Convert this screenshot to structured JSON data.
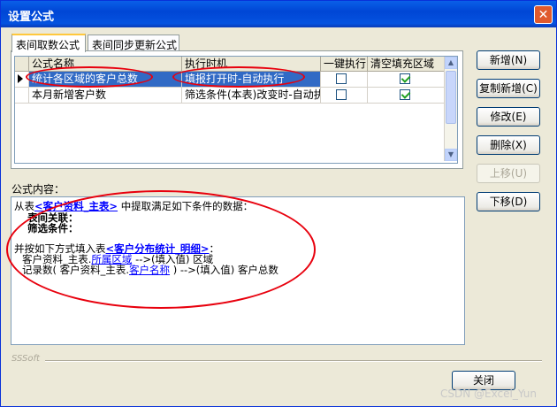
{
  "window": {
    "title": "设置公式",
    "close_glyph": "✕"
  },
  "tabs": [
    {
      "label": "表间取数公式",
      "active": true
    },
    {
      "label": "表间同步更新公式",
      "active": false
    }
  ],
  "grid": {
    "columns": [
      "公式名称",
      "执行时机",
      "一键执行",
      "清空填充区域"
    ],
    "rows": [
      {
        "name": "统计各区域的客户总数",
        "timing": "填报打开时-自动执行",
        "one_click": false,
        "clear_fill": true,
        "selected": true
      },
      {
        "name": "本月新增客户数",
        "timing": "筛选条件(本表)改变时-自动执",
        "one_click": false,
        "clear_fill": true,
        "selected": false
      }
    ]
  },
  "buttons": {
    "add": "新增(N)",
    "copy_add": "复制新增(C)",
    "edit": "修改(E)",
    "delete": "删除(X)",
    "move_up": "上移(U)",
    "move_down": "下移(D)",
    "close": "关闭"
  },
  "formula": {
    "label": "公式内容：",
    "line1_prefix": "从表",
    "line1_table": "<客户资料_主表>",
    "line1_suffix": "中提取满足如下条件的数据：",
    "line2": "表间关联：",
    "line3": "筛选条件：",
    "line5_prefix": "并按如下方式填入表",
    "line5_table": "<客户分布统计_明细>",
    "line5_suffix": "：",
    "line6_src": "客户资料_主表.",
    "line6_field": "所属区域",
    "line6_arrow": "-->(填入值) 区域",
    "line7_prefix": "记录数( 客户资料_主表.",
    "line7_field": "客户名称",
    "line7_suffix": ") -->(填入值) 客户总数"
  },
  "footer": {
    "brand": "SSSoft",
    "watermark": "CSDN @Excel_Yun"
  },
  "colors": {
    "titlebar": "#0054E3",
    "selection": "#316AC5",
    "annotation": "#E8000D",
    "link": "#0000FF"
  }
}
